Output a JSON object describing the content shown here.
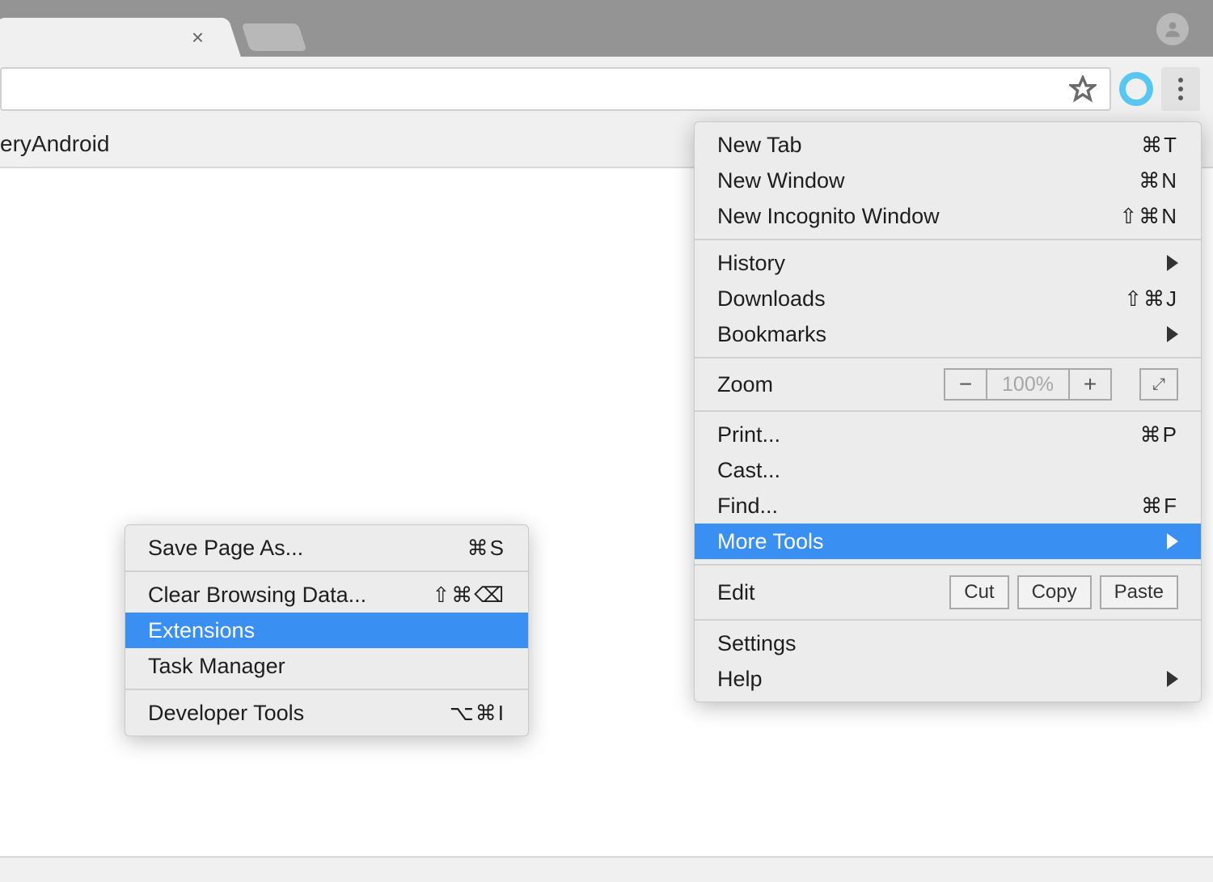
{
  "page": {
    "heading_fragment": "eryAndroid"
  },
  "menu": {
    "group1": [
      {
        "label": "New Tab",
        "shortcut": "⌘T"
      },
      {
        "label": "New Window",
        "shortcut": "⌘N"
      },
      {
        "label": "New Incognito Window",
        "shortcut": "⇧⌘N"
      }
    ],
    "group2": [
      {
        "label": "History",
        "submenu": true
      },
      {
        "label": "Downloads",
        "shortcut": "⇧⌘J"
      },
      {
        "label": "Bookmarks",
        "submenu": true
      }
    ],
    "zoom": {
      "label": "Zoom",
      "value": "100%"
    },
    "group3": [
      {
        "label": "Print...",
        "shortcut": "⌘P"
      },
      {
        "label": "Cast..."
      },
      {
        "label": "Find...",
        "shortcut": "⌘F"
      },
      {
        "label": "More Tools",
        "submenu": true,
        "selected": true
      }
    ],
    "edit": {
      "label": "Edit",
      "buttons": [
        "Cut",
        "Copy",
        "Paste"
      ]
    },
    "group4": [
      {
        "label": "Settings"
      },
      {
        "label": "Help",
        "submenu": true
      }
    ]
  },
  "submenu": {
    "group1": [
      {
        "label": "Save Page As...",
        "shortcut": "⌘S"
      }
    ],
    "group2": [
      {
        "label": "Clear Browsing Data...",
        "shortcut": "⇧⌘⌫"
      },
      {
        "label": "Extensions",
        "selected": true
      },
      {
        "label": "Task Manager"
      }
    ],
    "group3": [
      {
        "label": "Developer Tools",
        "shortcut": "⌥⌘I"
      }
    ]
  }
}
